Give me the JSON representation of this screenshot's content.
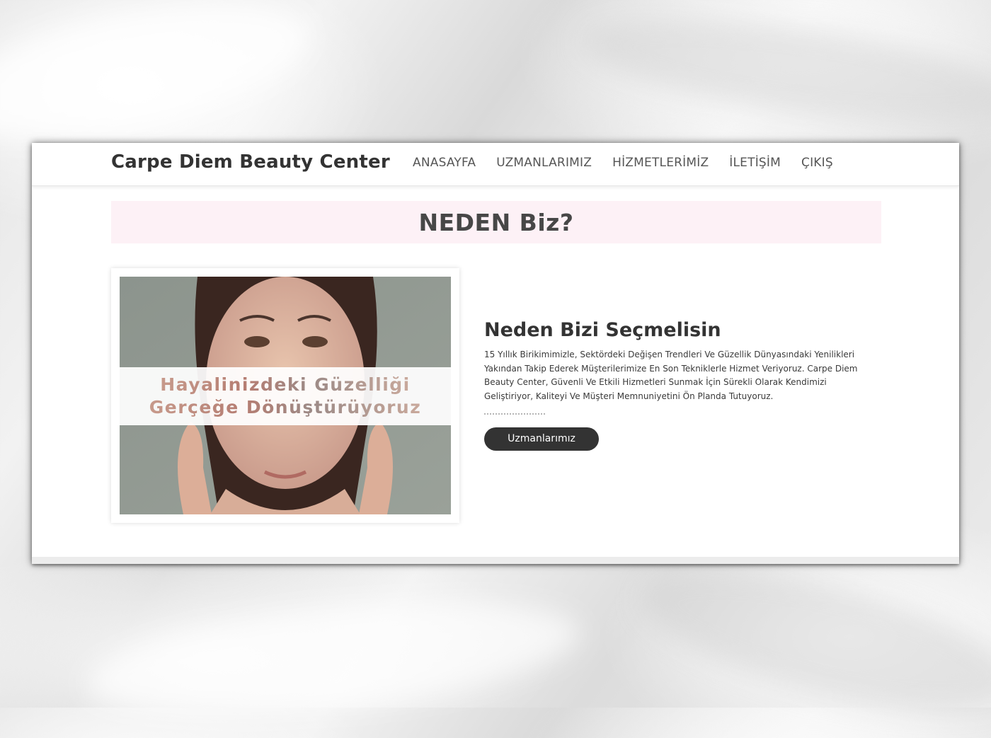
{
  "site": {
    "brand": "Carpe Diem Beauty Center",
    "nav": [
      {
        "label": "ANASAYFA"
      },
      {
        "label": "UZMANLARIMIZ"
      },
      {
        "label": "HİZMETLERİMİZ"
      },
      {
        "label": "İLETİŞİM"
      },
      {
        "label": "ÇIKIŞ"
      }
    ]
  },
  "banner": {
    "title": "NEDEN Biz?"
  },
  "feature": {
    "image": {
      "line1": "Hayalinizdeki Güzelliği",
      "line2": "Gerçeğe Dönüştürüyoruz"
    },
    "heading": "Neden Bizi Seçmelisin",
    "body": "15 Yıllık Birikimimizle, Sektördeki Değişen Trendleri Ve Güzellik Dünyasındaki Yenilikleri Yakından Takip Ederek Müşterilerimize En Son Tekniklerle Hizmet Veriyoruz. Carpe Diem Beauty Center, Güvenli Ve Etkili Hizmetleri Sunmak İçin Sürekli Olarak Kendimizi Geliştiriyor, Kaliteyi Ve Müşteri Memnuniyetini Ön Planda Tutuyoruz.",
    "button": "Uzmanlarımız"
  },
  "colors": {
    "banner_bg": "#fdf1f6",
    "button_bg": "#333333",
    "text_dark": "#333333"
  }
}
